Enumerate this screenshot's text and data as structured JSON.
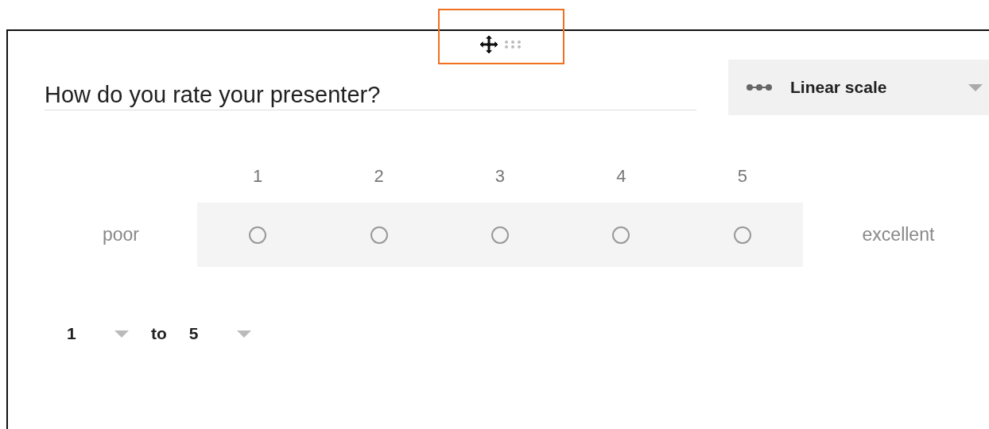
{
  "question": {
    "title": "How do you rate your presenter?"
  },
  "question_type": {
    "label": "Linear scale"
  },
  "scale": {
    "low_label": "poor",
    "high_label": "excellent",
    "options": [
      {
        "number": "1",
        "selected": false
      },
      {
        "number": "2",
        "selected": false
      },
      {
        "number": "3",
        "selected": false
      },
      {
        "number": "4",
        "selected": false
      },
      {
        "number": "5",
        "selected": false
      }
    ]
  },
  "range": {
    "from": "1",
    "separator": "to",
    "to": "5"
  }
}
